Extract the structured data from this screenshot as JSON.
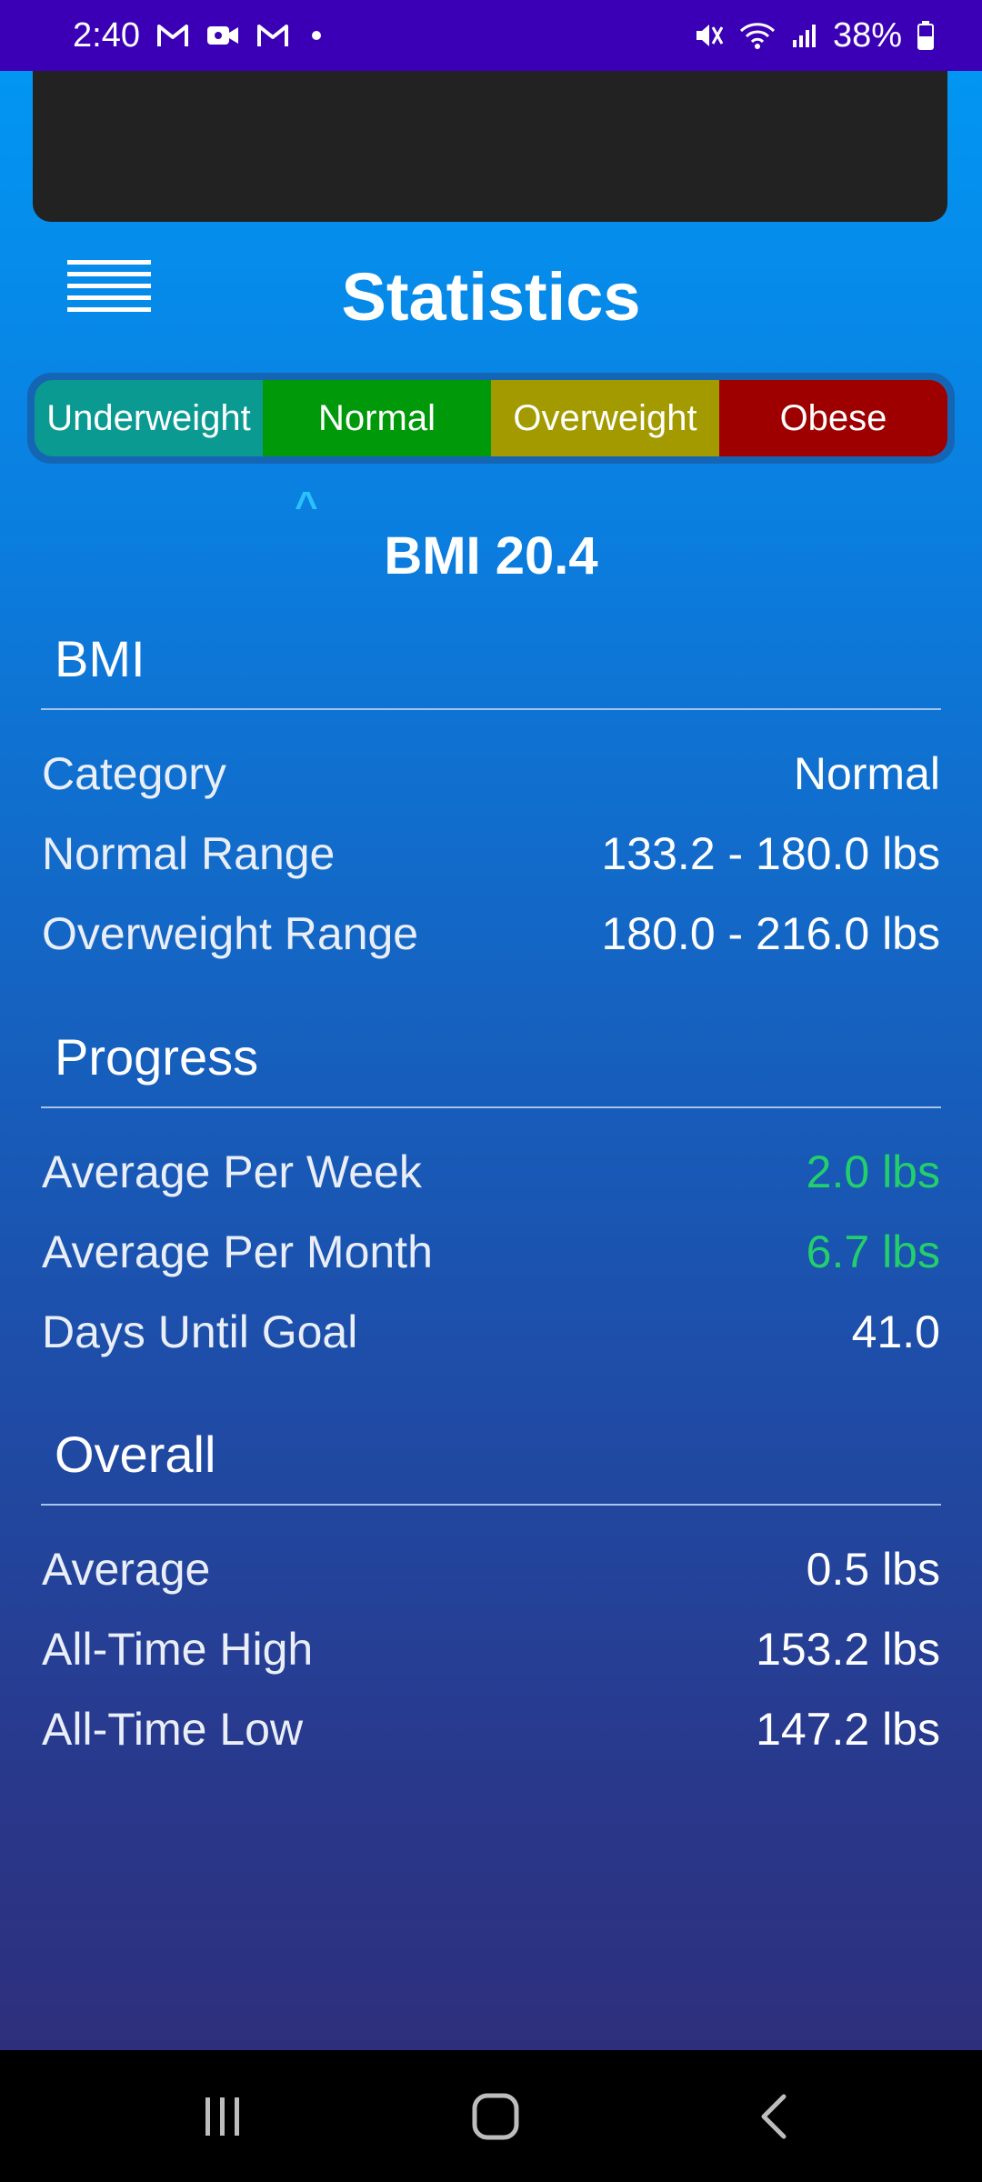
{
  "status": {
    "time": "2:40",
    "battery": "38%"
  },
  "header": {
    "title": "Statistics"
  },
  "bmi_bar": {
    "segments": [
      "Underweight",
      "Normal",
      "Overweight",
      "Obese"
    ],
    "pointer": "^",
    "value_label": "BMI 20.4"
  },
  "sections": {
    "bmi": {
      "title": "BMI",
      "rows": [
        {
          "label": "Category",
          "value": "Normal"
        },
        {
          "label": "Normal Range",
          "value": "133.2 - 180.0 lbs"
        },
        {
          "label": "Overweight Range",
          "value": "180.0 - 216.0 lbs"
        }
      ]
    },
    "progress": {
      "title": "Progress",
      "rows": [
        {
          "label": "Average Per Week",
          "value": "2.0 lbs"
        },
        {
          "label": "Average Per Month",
          "value": "6.7 lbs"
        },
        {
          "label": "Days Until Goal",
          "value": "41.0"
        }
      ]
    },
    "overall": {
      "title": "Overall",
      "rows": [
        {
          "label": "Average",
          "value": "0.5 lbs"
        },
        {
          "label": "All-Time High",
          "value": "153.2 lbs"
        },
        {
          "label": "All-Time Low",
          "value": "147.2 lbs"
        }
      ]
    }
  },
  "colors": {
    "underweight": "#0b9a92",
    "normal": "#00990a",
    "overweight": "#a39a00",
    "obese": "#9e0000",
    "positive": "#23cf6b",
    "status_bar": "#3b00b5"
  },
  "icons": {
    "menu": "hamburger-menu-icon",
    "nav_recents": "recents-icon",
    "nav_home": "home-icon",
    "nav_back": "back-icon"
  }
}
